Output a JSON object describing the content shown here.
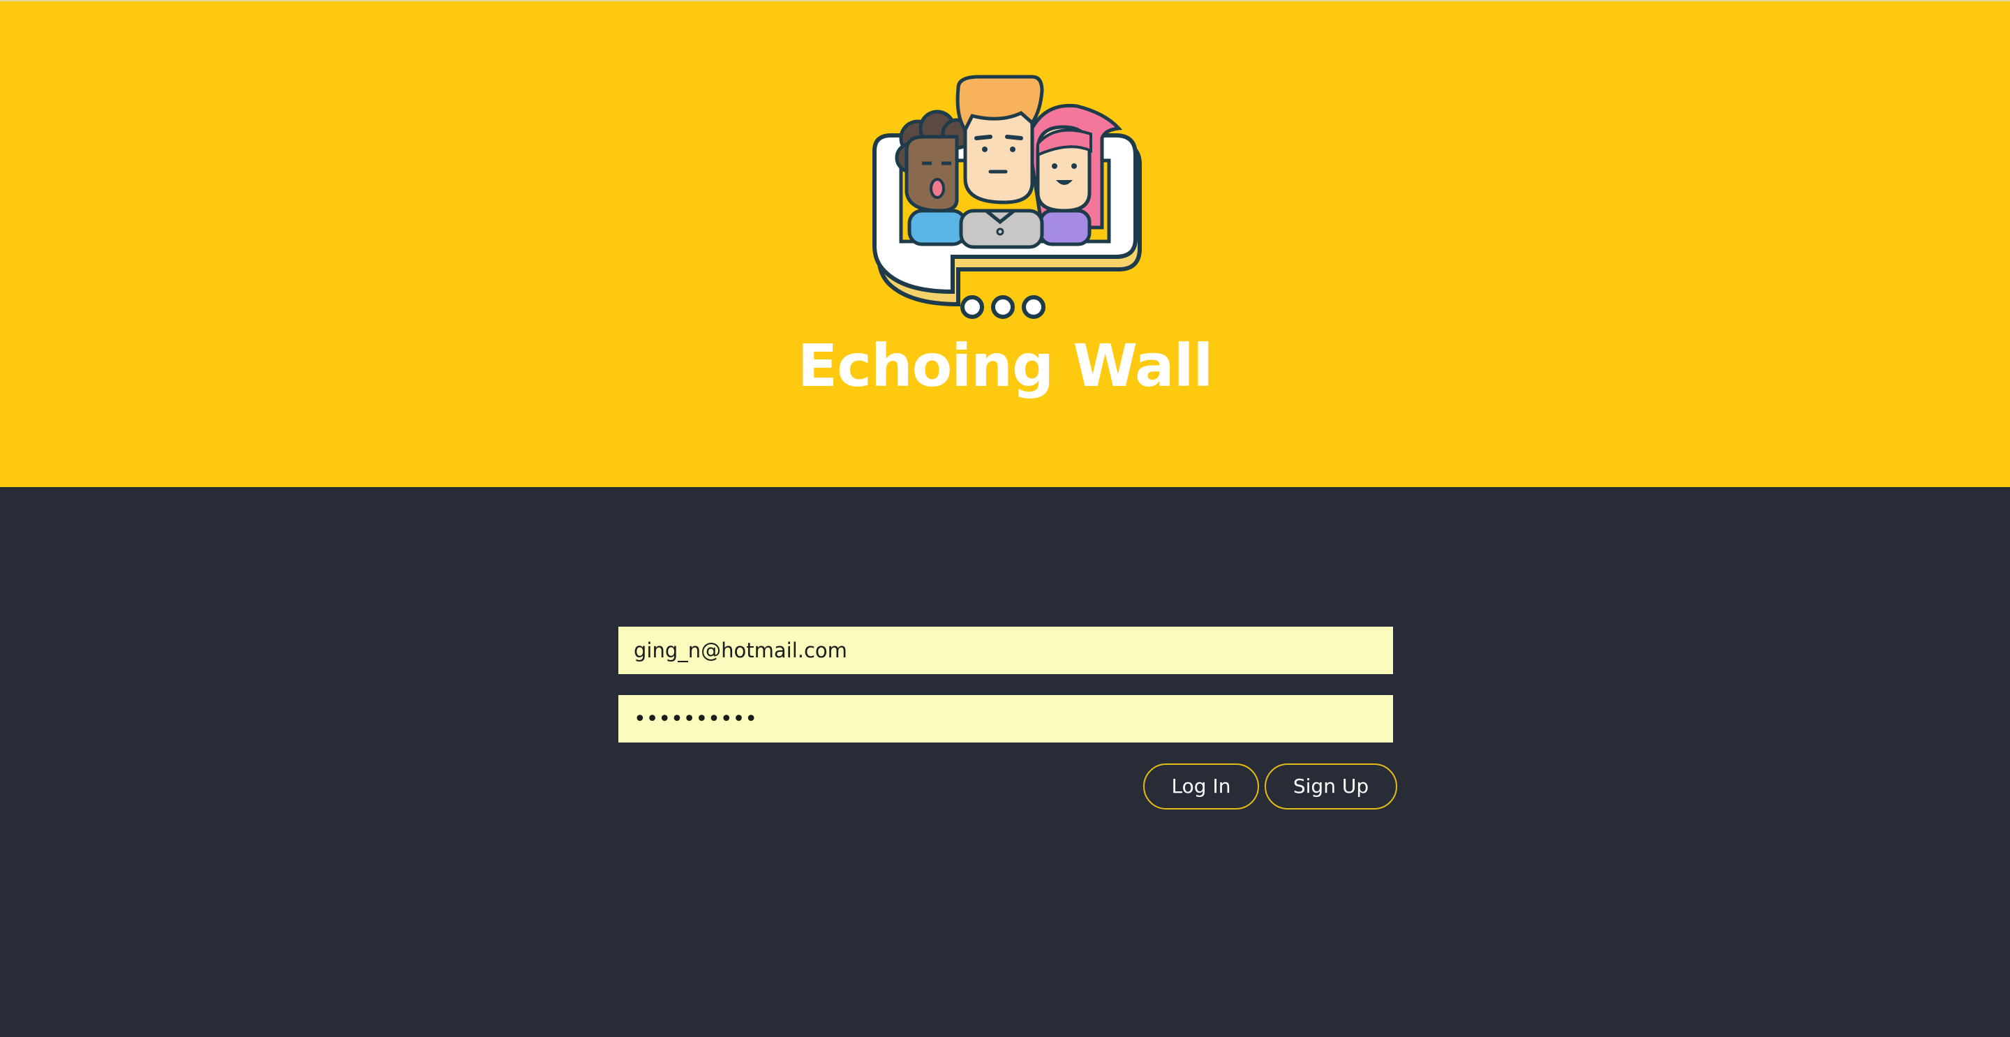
{
  "app": {
    "title": "Echoing Wall",
    "logo_icon": "echoing-wall-logo"
  },
  "login_form": {
    "email_value": "ging_n@hotmail.com",
    "password_value": "••••••••••"
  },
  "actions": {
    "login_label": "Log In",
    "signup_label": "Sign Up"
  },
  "colors": {
    "hero_background": "#fec90f",
    "page_background": "#282c37",
    "input_background": "#fafbbd",
    "button_border": "#e3bb16"
  }
}
